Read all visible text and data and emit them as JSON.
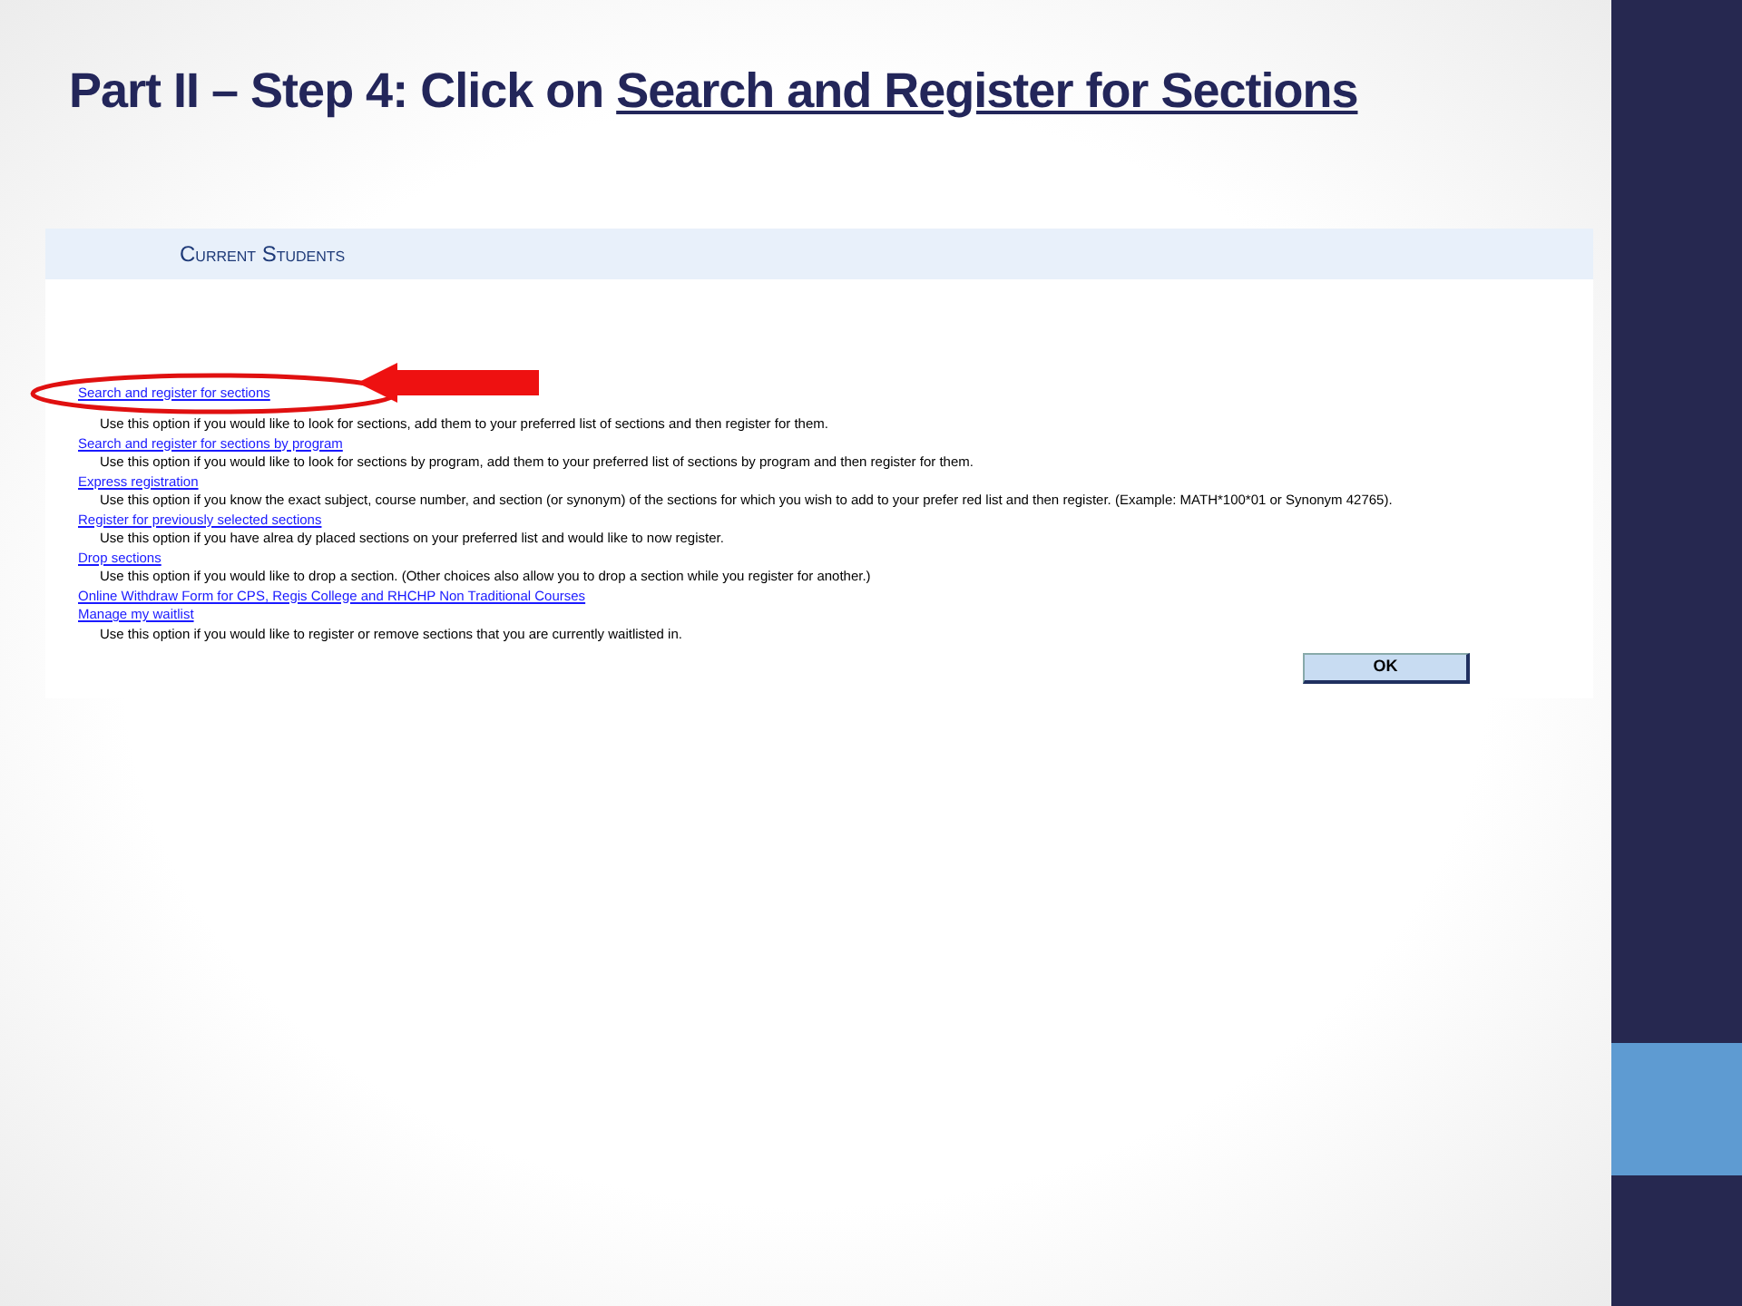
{
  "slide_title": {
    "prefix": "Part II – Step 4: Click on ",
    "link": "Search and Register for Sections"
  },
  "page": {
    "heading": "Current Students",
    "options": [
      {
        "link": "Search and register for sections",
        "description": "Use this option if you would like to look for sections, add them to your preferred list of sections and then register for them.",
        "highlighted": true
      },
      {
        "link": "Search and register for sections by program",
        "description": "Use this option if you would like to look for sections by program, add them to your preferred list of sections by program and then register for them.",
        "highlighted": false
      },
      {
        "link": "Express registration",
        "description": "Use this option if you know the exact subject, course number, and section (or synonym) of the sections for which you wish to add to your prefer red list and then register. (Example: MATH*100*01 or Synonym 42765).",
        "highlighted": false
      },
      {
        "link": "Register for previously selected sections",
        "description": "Use this option if you have alrea dy placed sections on your preferred list and would like to now register.",
        "highlighted": false
      },
      {
        "link": "Drop sections",
        "description": "Use this option if you would like to drop a section. (Other choices also allow you to drop a section while you register for another.)",
        "highlighted": false
      },
      {
        "link": "Online Withdraw Form for CPS, Regis College and RHCHP Non Traditional Courses",
        "highlighted": false
      },
      {
        "link": "Manage my waitlist",
        "description": "Use this option if you would like to register or remove sections that you are currently waitlisted in.",
        "highlighted": false
      }
    ],
    "ok_button": "OK"
  }
}
